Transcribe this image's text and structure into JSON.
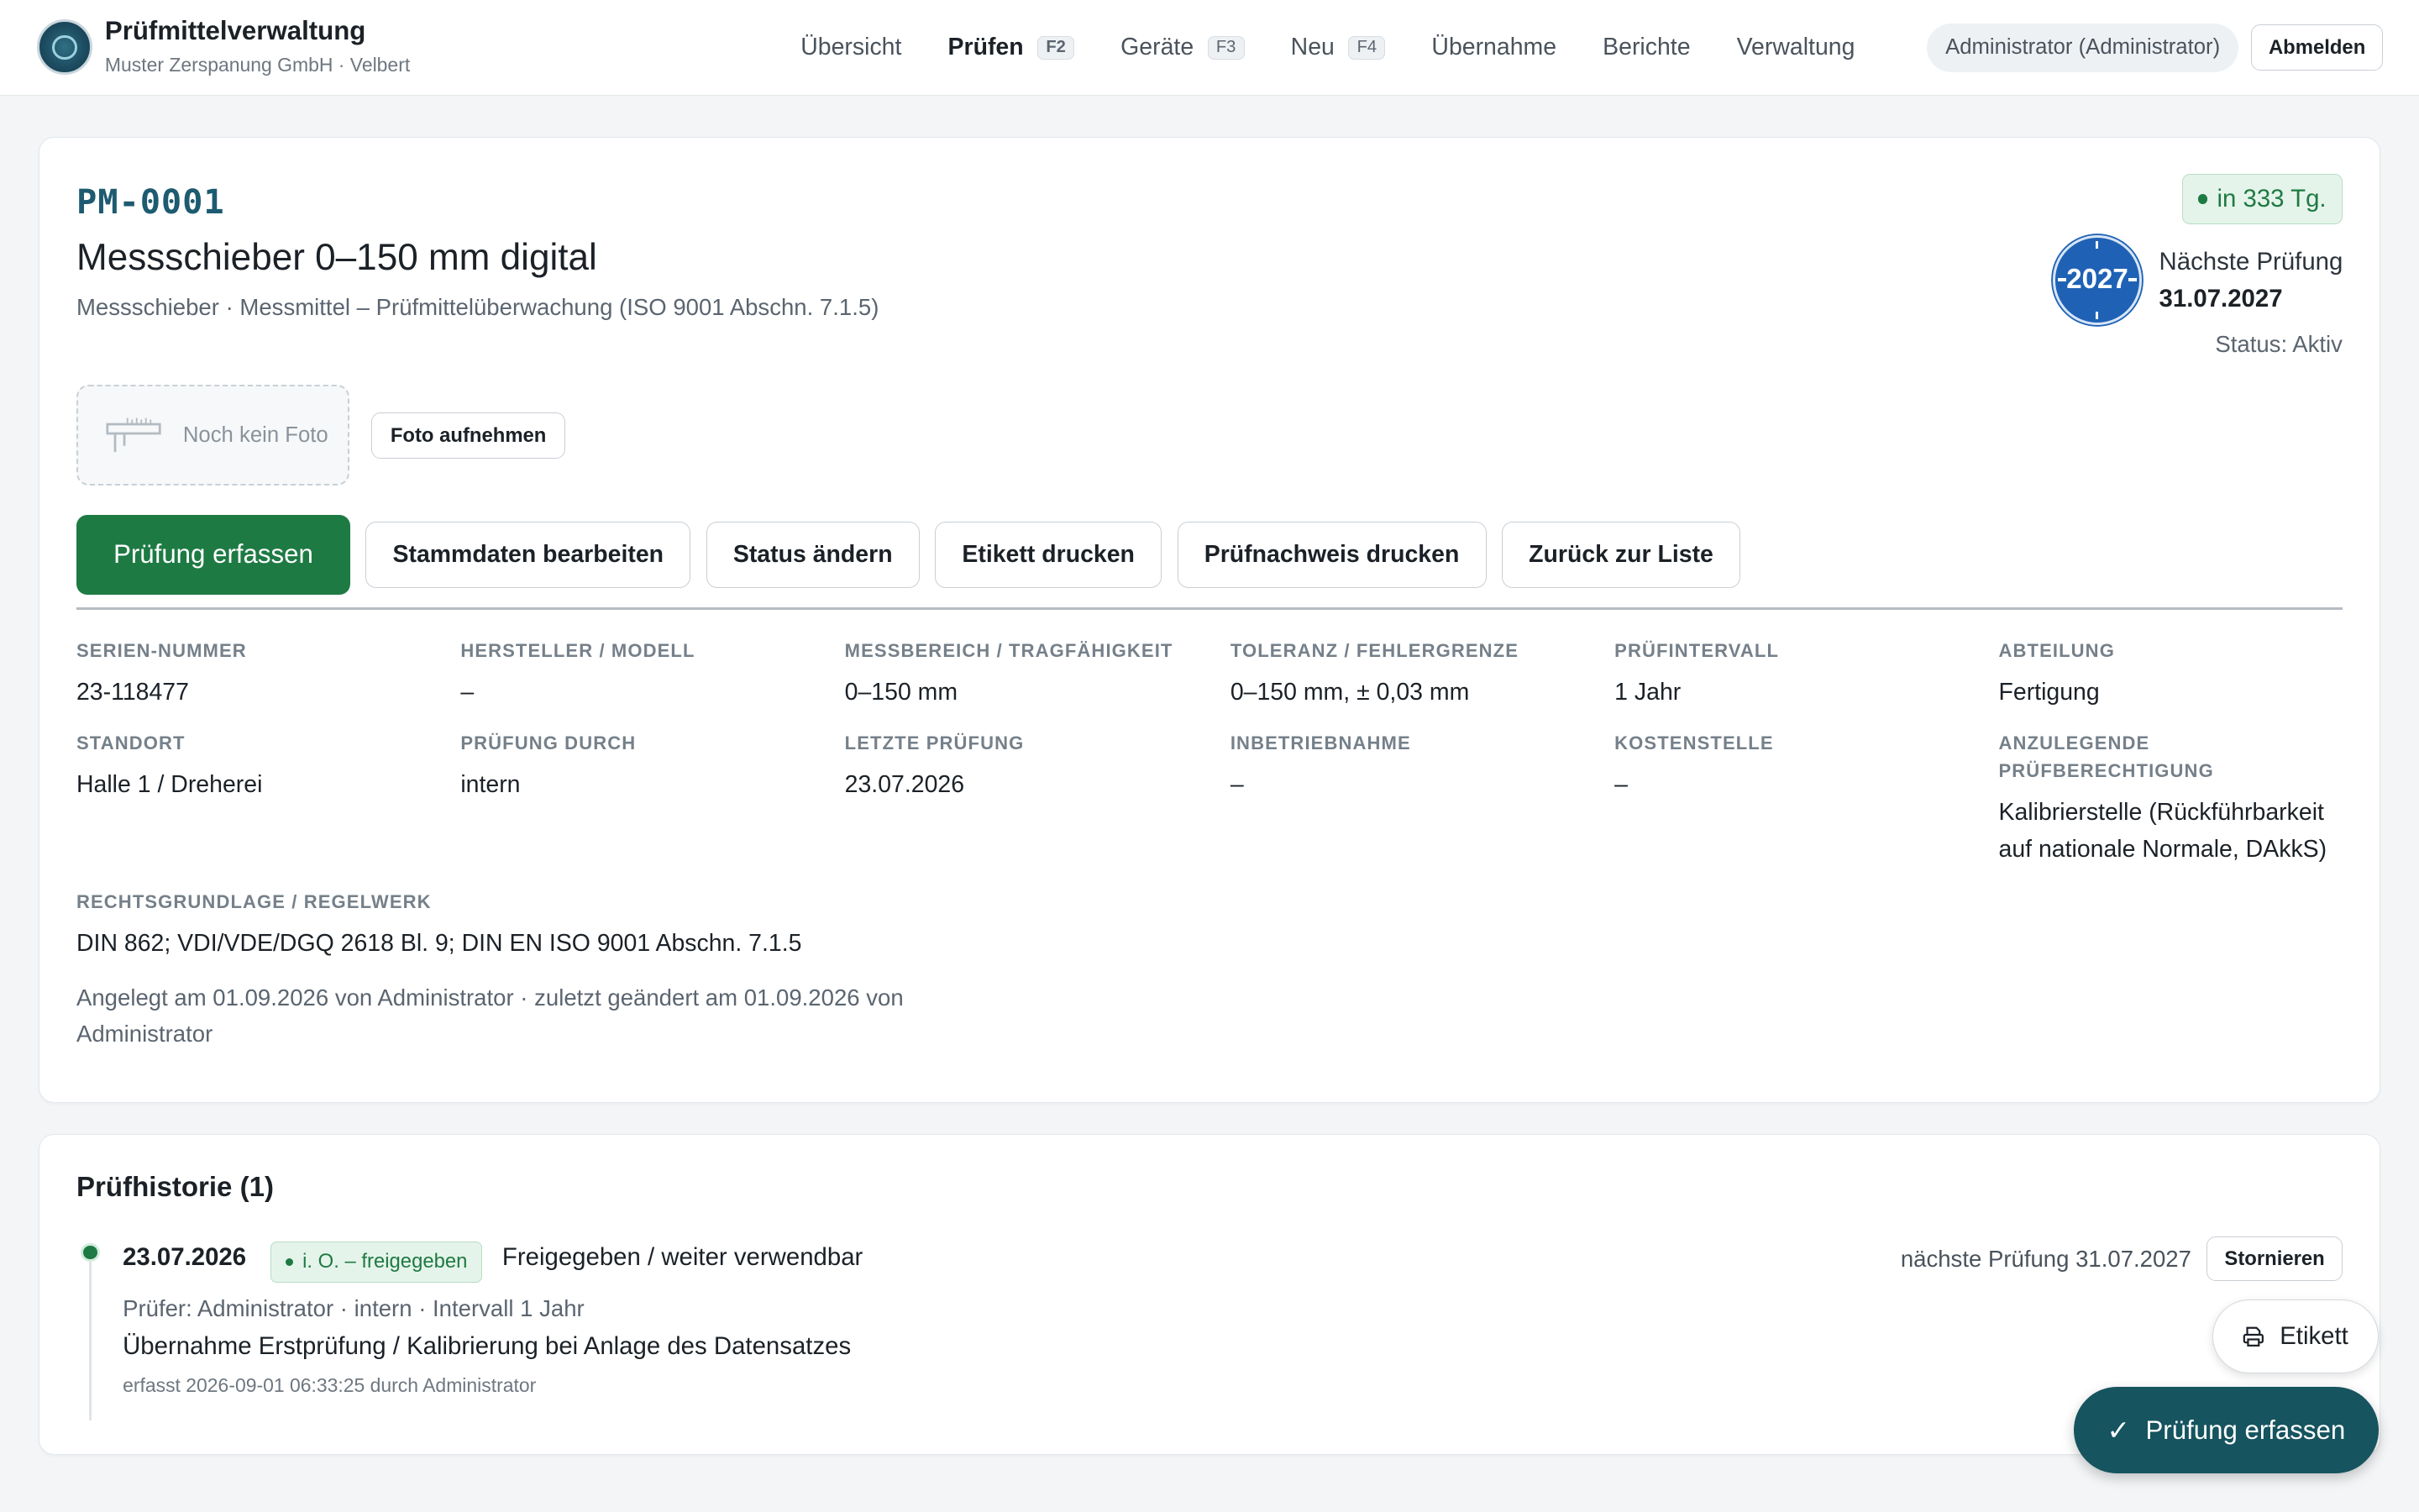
{
  "header": {
    "app_title": "Prüfmittelverwaltung",
    "app_subtitle": "Muster Zerspanung GmbH · Velbert",
    "nav": [
      {
        "label": "Übersicht",
        "kbd": ""
      },
      {
        "label": "Prüfen",
        "kbd": "F2",
        "active": true
      },
      {
        "label": "Geräte",
        "kbd": "F3"
      },
      {
        "label": "Neu",
        "kbd": "F4"
      },
      {
        "label": "Übernahme",
        "kbd": ""
      },
      {
        "label": "Berichte",
        "kbd": ""
      },
      {
        "label": "Verwaltung",
        "kbd": ""
      }
    ],
    "user": "Administrator (Administrator)",
    "logout": "Abmelden"
  },
  "device": {
    "id": "PM-0001",
    "title": "Messschieber 0–150 mm digital",
    "subtitle": "Messschieber · Messmittel – Prüfmittelüberwachung (ISO 9001 Abschn. 7.1.5)",
    "due_badge": "in 333 Tg.",
    "seal_year": "2027",
    "next_label": "Nächste Prüfung",
    "next_date": "31.07.2027",
    "status": "Status: Aktiv",
    "photo_placeholder": "Noch kein Foto",
    "photo_button": "Foto aufnehmen"
  },
  "actions": {
    "primary": "Prüfung erfassen",
    "edit": "Stammdaten bearbeiten",
    "status": "Status ändern",
    "label": "Etikett drucken",
    "proof": "Prüfnachweis drucken",
    "back": "Zurück zur Liste"
  },
  "fields": {
    "serial": {
      "label": "SERIEN-NUMMER",
      "value": "23-118477"
    },
    "manufacturer": {
      "label": "HERSTELLER / MODELL",
      "value": "–"
    },
    "range": {
      "label": "MESSBEREICH / TRAGFÄHIGKEIT",
      "value": "0–150 mm"
    },
    "tolerance": {
      "label": "TOLERANZ / FEHLERGRENZE",
      "value": "0–150 mm, ± 0,03 mm"
    },
    "interval": {
      "label": "PRÜFINTERVALL",
      "value": "1 Jahr"
    },
    "department": {
      "label": "ABTEILUNG",
      "value": "Fertigung"
    },
    "location": {
      "label": "STANDORT",
      "value": "Halle 1 / Dreherei"
    },
    "inspected_by": {
      "label": "PRÜFUNG DURCH",
      "value": "intern"
    },
    "last_check": {
      "label": "LETZTE PRÜFUNG",
      "value": "23.07.2026"
    },
    "commissioning": {
      "label": "INBETRIEBNAHME",
      "value": "–"
    },
    "cost_center": {
      "label": "KOSTENSTELLE",
      "value": "–"
    },
    "qualification": {
      "label": "ANZULEGENDE PRÜFBERECHTIGUNG",
      "value": "Kalibrierstelle (Rückführbarkeit auf nationale Normale, DAkkS)"
    },
    "legal": {
      "label": "RECHTSGRUNDLAGE / REGELWERK",
      "value": "DIN 862; VDI/VDE/DGQ 2618 Bl. 9; DIN EN ISO 9001 Abschn. 7.1.5"
    }
  },
  "meta": "Angelegt am 01.09.2026 von Administrator · zuletzt geändert am 01.09.2026 von Administrator",
  "history": {
    "title": "Prüfhistorie (1)",
    "entries": [
      {
        "date": "23.07.2026",
        "badge": "i. O. – freigegeben",
        "result": "Freigegeben / weiter verwendbar",
        "next": "nächste Prüfung 31.07.2027",
        "cancel": "Stornieren",
        "line2": "Prüfer: Administrator · intern · Intervall 1 Jahr",
        "line3": "Übernahme Erstprüfung / Kalibrierung bei Anlage des Datensatzes",
        "line4": "erfasst 2026-09-01 06:33:25 durch Administrator"
      }
    ]
  },
  "floating": {
    "etikett": "Etikett",
    "pruefung": "Prüfung erfassen"
  },
  "colors": {
    "primary_green": "#1e7a43",
    "teal": "#16545f",
    "seal_blue": "#1f62b5",
    "id_color": "#1d5b70"
  },
  "icons": {
    "logo": "gauge-logo-icon",
    "photo": "caliper-icon",
    "etikett": "print-icon",
    "check": "checkmark-icon"
  }
}
